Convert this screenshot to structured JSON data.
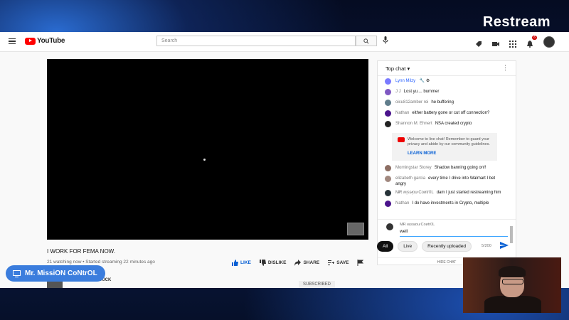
{
  "stream": {
    "brand": "Restream"
  },
  "header": {
    "logo_text": "YouTube",
    "search_placeholder": "Search",
    "notification_count": "6"
  },
  "video": {
    "title": "I WORK FOR FEMA NOW.",
    "meta": "21 watching now • Started streaming 22 minutes ago",
    "actions": {
      "like": "LIKE",
      "dislike": "DISLIKE",
      "share": "SHARE",
      "save": "SAVE"
    },
    "channel": "DEPLORABLE DUCK",
    "subscribe": "SUBSCRIBED"
  },
  "chat": {
    "mode": "Top chat",
    "messages": [
      {
        "author": "Lynn Milzy",
        "text": "",
        "color": "#7a7aff",
        "moderator": true
      },
      {
        "author": "J J",
        "text": "Lost yu.... bummer",
        "color": "#7e57c2"
      },
      {
        "author": "oicu812amber rei",
        "text": "he buffering",
        "color": "#607d8b"
      },
      {
        "author": "Nathan",
        "text": "either battery gone or cut off connection?",
        "color": "#4a148c"
      },
      {
        "author": "Shannon M. Ehnert",
        "text": "NSA created crypto",
        "color": "#222222"
      }
    ],
    "notice": {
      "text": "Welcome to live chat! Remember to guard your privacy and abide by our community guidelines.",
      "link": "LEARN MORE"
    },
    "messages2": [
      {
        "author": "Morningstar Storey",
        "text": "Shadow banning going on!!",
        "color": "#8d6e63"
      },
      {
        "author": "elizabeth garcia",
        "text": "every time I drive into Walmart I bet angry",
        "color": "#a1887f"
      },
      {
        "author": "M̷R ʍᴉss̷ᴉou̷ Coᴎtr0L",
        "text": "dam I just started restreaming him",
        "color": "#263238"
      },
      {
        "author": "Nathan",
        "text": "I do have investments in Crypto, multiple",
        "color": "#4a148c"
      }
    ],
    "input": {
      "user": "M̷R ʍᴉss̷ᴉou̷ Coᴎtr0L",
      "value": "well",
      "counter": "5/200"
    },
    "hide_label": "HIDE CHAT"
  },
  "chips": [
    "All",
    "Live",
    "Recently uploaded"
  ],
  "overlay": {
    "name": "Mr. MissiON CoNtrOL"
  }
}
